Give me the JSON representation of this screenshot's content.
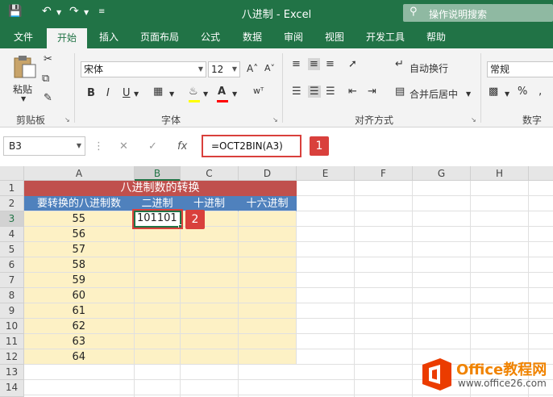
{
  "window": {
    "title": "八进制 - Excel",
    "tell_me": "操作说明搜索"
  },
  "quick_access": {
    "icons": [
      "save-icon",
      "undo-icon",
      "redo-icon",
      "customize-icon"
    ]
  },
  "tabs": [
    {
      "label": "文件"
    },
    {
      "label": "开始"
    },
    {
      "label": "插入"
    },
    {
      "label": "页面布局"
    },
    {
      "label": "公式"
    },
    {
      "label": "数据"
    },
    {
      "label": "审阅"
    },
    {
      "label": "视图"
    },
    {
      "label": "开发工具"
    },
    {
      "label": "帮助"
    }
  ],
  "active_tab": "开始",
  "ribbon": {
    "clipboard": {
      "paste_label": "粘贴",
      "group_label": "剪贴板"
    },
    "font": {
      "font_name": "宋体",
      "font_size": "12",
      "bold": "B",
      "italic": "I",
      "underline": "U",
      "group_label": "字体"
    },
    "alignment": {
      "wrap_text": "自动换行",
      "merge_center": "合并后居中",
      "group_label": "对齐方式"
    },
    "number": {
      "format": "常规",
      "percent": "%",
      "group_label": "数字"
    }
  },
  "formula_bar": {
    "name_box": "B3",
    "fx": "fx",
    "formula": "=OCT2BIN(A3)"
  },
  "callouts": {
    "one": "1",
    "two": "2"
  },
  "sheet": {
    "columns": [
      "A",
      "B",
      "C",
      "D",
      "E",
      "F",
      "G",
      "H"
    ],
    "rows": [
      "1",
      "2",
      "3",
      "4",
      "5",
      "6",
      "7",
      "8",
      "9",
      "10",
      "11",
      "12",
      "13",
      "14"
    ],
    "title": "八进制数的转换",
    "headers": [
      "要转换的八进制数",
      "二进制",
      "十进制",
      "十六进制"
    ],
    "values": [
      "55",
      "56",
      "57",
      "58",
      "59",
      "60",
      "61",
      "62",
      "63",
      "64"
    ],
    "b3_result": "101101",
    "selected_cell": "B3"
  },
  "colors": {
    "excel_green": "#217346",
    "title_red": "#c0504d",
    "header_blue": "#4f81bd",
    "data_yellow": "#fdf1c5",
    "callout_red": "#d9403c"
  },
  "watermark": {
    "brand": "Office教程网",
    "url": "www.office26.com"
  }
}
